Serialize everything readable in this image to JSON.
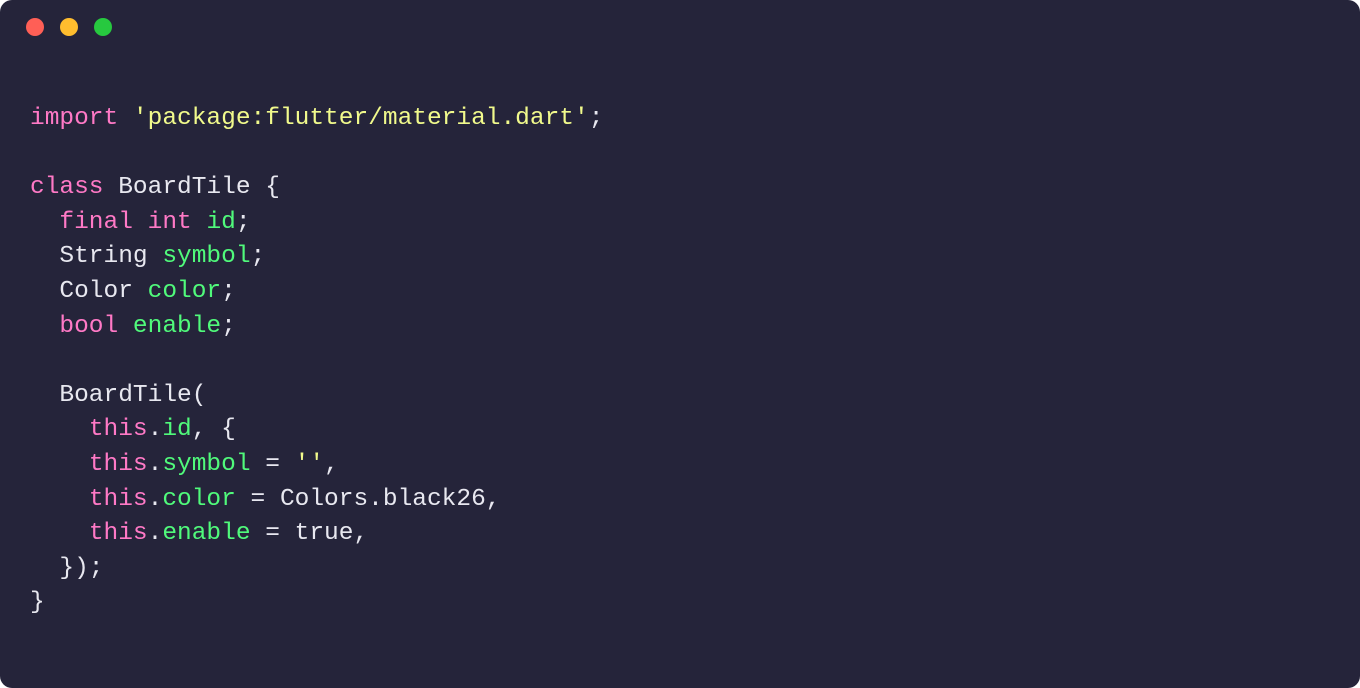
{
  "window": {
    "traffic": {
      "red": "#ff5f56",
      "yellow": "#ffbd2e",
      "green": "#27c93f"
    }
  },
  "code": {
    "kw_import": "import",
    "str_import": "'package:flutter/material.dart'",
    "semi": ";",
    "blank": "",
    "kw_class": "class",
    "sp": " ",
    "cls_name": "BoardTile",
    "brace_open": " {",
    "indent1": "  ",
    "indent2": "    ",
    "indent3": "      ",
    "kw_final": "final",
    "ty_int": "int",
    "id_field": "id",
    "ty_String": "String",
    "symbol_field": "symbol",
    "ty_Color": "Color",
    "color_field": "color",
    "ty_bool": "bool",
    "enable_field": "enable",
    "ctor_name": "BoardTile",
    "paren_open": "(",
    "kw_this": "this",
    "dot": ".",
    "comma_brace": ", {",
    "eq": " = ",
    "str_empty": "''",
    "comma": ",",
    "colors_black26": "Colors.black26",
    "lit_true": "true",
    "brace_close_paren": "});",
    "brace_close": "}"
  }
}
